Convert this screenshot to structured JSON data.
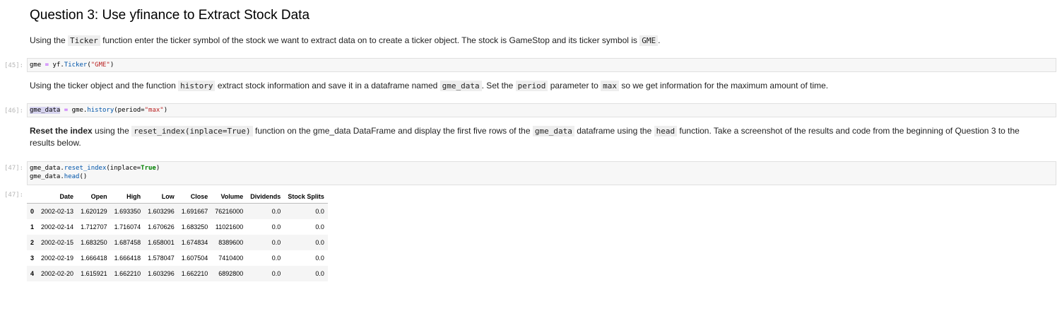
{
  "heading": "Question 3: Use yfinance to Extract Stock Data",
  "para1": {
    "t1": "Using the ",
    "c1": "Ticker",
    "t2": " function enter the ticker symbol of the stock we want to extract data on to create a ticker object. The stock is GameStop and its ticker symbol is ",
    "c2": "GME",
    "t3": "."
  },
  "cell45": {
    "prompt": "[45]:",
    "var": "gme",
    "op": " = ",
    "obj": "yf",
    "dot": ".",
    "attr": "Ticker",
    "open": "(",
    "str": "\"GME\"",
    "close": ")"
  },
  "para2": {
    "t1": "Using the ticker object and the function ",
    "c1": "history",
    "t2": " extract stock information and save it in a dataframe named ",
    "c2": "gme_data",
    "t3": ". Set the ",
    "c3": "period",
    "t4": " parameter to ",
    "c4": "max",
    "t5": " so we get information for the maximum amount of time."
  },
  "cell46": {
    "prompt": "[46]:",
    "var": "gme_data",
    "op": " = ",
    "obj": "gme",
    "dot": ".",
    "attr": "history",
    "open": "(period=",
    "str": "\"max\"",
    "close": ")"
  },
  "para3": {
    "bold": "Reset the index",
    "t1": " using the ",
    "c1": "reset_index(inplace=True)",
    "t2": " function on the gme_data DataFrame and display the first five rows of the ",
    "c2": "gme_data",
    "t3": " dataframe using the ",
    "c3": "head",
    "t4": " function. Take a screenshot of the results and code from the beginning of Question 3 to the results below."
  },
  "cell47": {
    "prompt": "[47]:",
    "l1_obj": "gme_data",
    "l1_dot": ".",
    "l1_attr": "reset_index",
    "l1_open": "(inplace=",
    "l1_kw": "True",
    "l1_close": ")",
    "l2_obj": "gme_data",
    "l2_dot": ".",
    "l2_attr": "head",
    "l2_close": "()"
  },
  "out47": {
    "prompt": "[47]:",
    "columns": [
      "",
      "Date",
      "Open",
      "High",
      "Low",
      "Close",
      "Volume",
      "Dividends",
      "Stock Splits"
    ],
    "rows": [
      [
        "0",
        "2002-02-13",
        "1.620129",
        "1.693350",
        "1.603296",
        "1.691667",
        "76216000",
        "0.0",
        "0.0"
      ],
      [
        "1",
        "2002-02-14",
        "1.712707",
        "1.716074",
        "1.670626",
        "1.683250",
        "11021600",
        "0.0",
        "0.0"
      ],
      [
        "2",
        "2002-02-15",
        "1.683250",
        "1.687458",
        "1.658001",
        "1.674834",
        "8389600",
        "0.0",
        "0.0"
      ],
      [
        "3",
        "2002-02-19",
        "1.666418",
        "1.666418",
        "1.578047",
        "1.607504",
        "7410400",
        "0.0",
        "0.0"
      ],
      [
        "4",
        "2002-02-20",
        "1.615921",
        "1.662210",
        "1.603296",
        "1.662210",
        "6892800",
        "0.0",
        "0.0"
      ]
    ]
  }
}
